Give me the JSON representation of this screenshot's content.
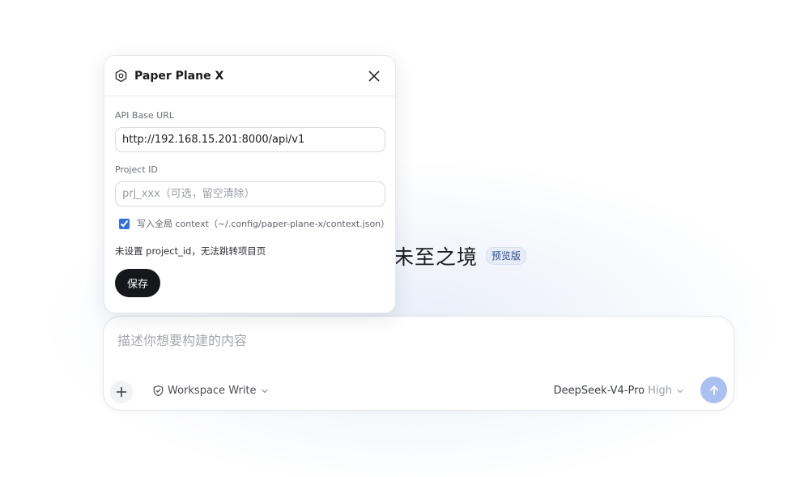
{
  "hero": {
    "title": "未至之境",
    "badge": "预览版"
  },
  "composer": {
    "placeholder": "描述你想要构建的内容",
    "permission_label": "Workspace Write",
    "model_name": "DeepSeek-V4-Pro",
    "effort_label": "High"
  },
  "popover": {
    "title": "Paper Plane X",
    "api_base_url": {
      "label": "API Base URL",
      "value": "http://192.168.15.201:8000/api/v1"
    },
    "project_id": {
      "label": "Project ID",
      "placeholder": "prj_xxx（可选，留空清除）",
      "value": ""
    },
    "global_context": {
      "label": "写入全局 context（~/.config/paper-plane-x/context.json）",
      "checked": true
    },
    "hint": "未设置 project_id，无法跳转项目页",
    "save_label": "保存"
  },
  "colors": {
    "accent": "#2f6fe4",
    "send_button": "#a9c0f0",
    "save_button": "#16171a"
  }
}
